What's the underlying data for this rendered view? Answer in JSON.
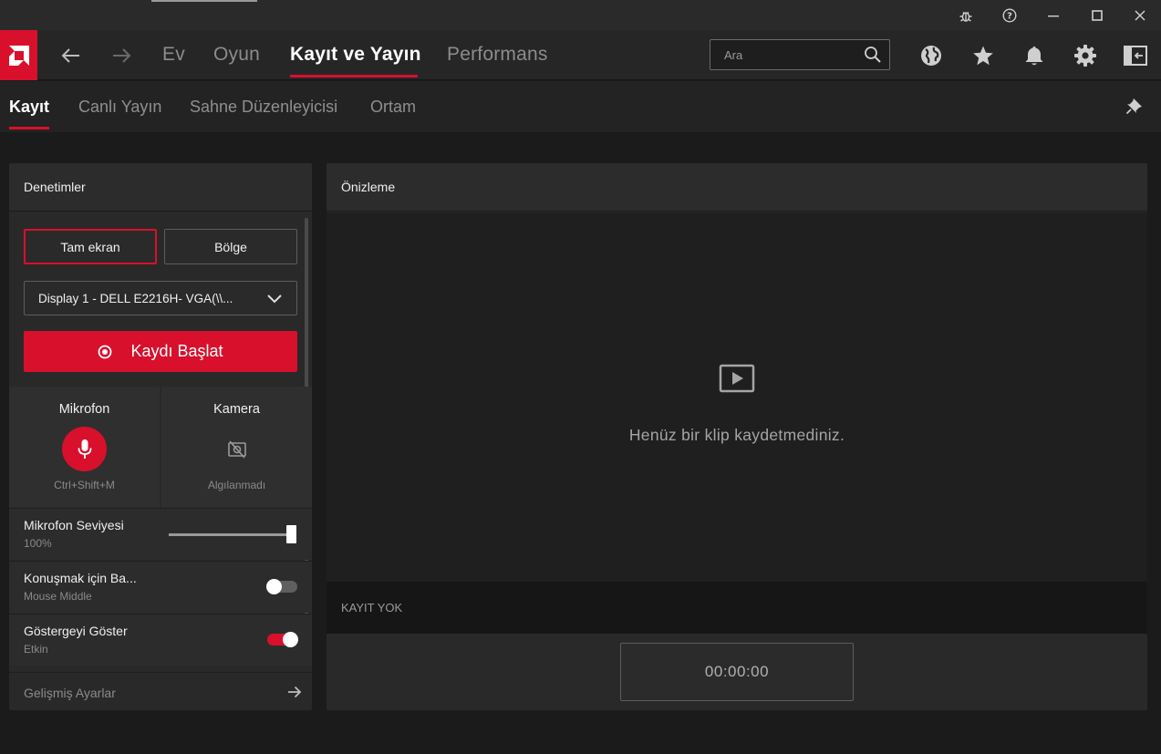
{
  "nav": {
    "items": [
      "Ev",
      "Oyun",
      "Kayıt ve Yayın",
      "Performans"
    ],
    "search_placeholder": "Ara"
  },
  "subnav": {
    "items": [
      "Kayıt",
      "Canlı Yayın",
      "Sahne Düzenleyicisi",
      "Ortam"
    ]
  },
  "controls": {
    "title": "Denetimler",
    "fullscreen": "Tam ekran",
    "region": "Bölge",
    "display": "Display 1 - DELL E2216H- VGA(\\\\...",
    "record": "Kaydı Başlat",
    "mic": {
      "label": "Mikrofon",
      "hotkey": "Ctrl+Shift+M"
    },
    "camera": {
      "label": "Kamera",
      "status": "Algılanmadı"
    },
    "mic_level": {
      "label": "Mikrofon Seviyesi",
      "value": "100%",
      "fraction": 1.0
    },
    "push_to_talk": {
      "label": "Konuşmak için Ba...",
      "value": "Mouse Middle",
      "on": false
    },
    "show_indicator": {
      "label": "Göstergeyi Göster",
      "value": "Etkin",
      "on": true
    },
    "advanced": "Gelişmiş Ayarlar"
  },
  "preview": {
    "title": "Önizleme",
    "empty": "Henüz bir klip kaydetmediniz.",
    "status": "KAYIT YOK",
    "timer": "00:00:00"
  },
  "colors": {
    "accent": "#d8102c",
    "bg": "#1b1b1b",
    "panel": "#292929"
  }
}
